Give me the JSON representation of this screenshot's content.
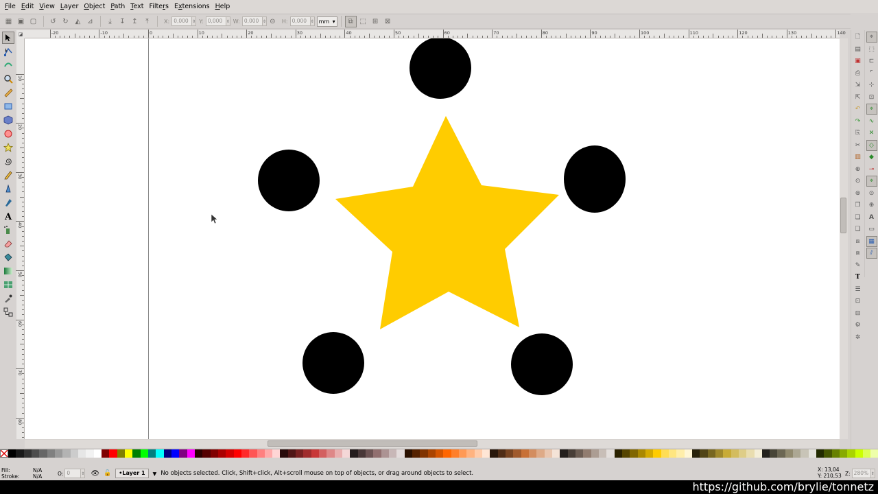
{
  "menu": [
    {
      "label": "File",
      "key": "F"
    },
    {
      "label": "Edit",
      "key": "E"
    },
    {
      "label": "View",
      "key": "V"
    },
    {
      "label": "Layer",
      "key": "L"
    },
    {
      "label": "Object",
      "key": "O"
    },
    {
      "label": "Path",
      "key": "P"
    },
    {
      "label": "Text",
      "key": "T"
    },
    {
      "label": "Filters",
      "key": "r"
    },
    {
      "label": "Extensions",
      "key": "x"
    },
    {
      "label": "Help",
      "key": "H"
    }
  ],
  "controls": {
    "x_label": "X:",
    "x_value": "0,000",
    "y_label": "Y:",
    "y_value": "0,000",
    "w_label": "W:",
    "w_value": "0,000",
    "h_label": "H:",
    "h_value": "0,000",
    "unit": "mm"
  },
  "hruler_labels": [
    "-20",
    "-10",
    "0",
    "10",
    "20",
    "30",
    "40",
    "50",
    "60",
    "70",
    "80",
    "90",
    "100",
    "110",
    "120",
    "130",
    "140"
  ],
  "vruler_labels": [
    "0",
    "10",
    "20",
    "30",
    "40",
    "50",
    "60",
    "70",
    "80",
    "90"
  ],
  "drawing": {
    "star_color": "#ffcc00",
    "circle_color": "#000000"
  },
  "palette": [
    "#000000",
    "#1a1a1a",
    "#333333",
    "#4d4d4d",
    "#666666",
    "#808080",
    "#999999",
    "#b3b3b3",
    "#cccccc",
    "#e6e6e6",
    "#f2f2f2",
    "#ffffff",
    "#800000",
    "#ff0000",
    "#808000",
    "#ffff00",
    "#008000",
    "#00ff00",
    "#008080",
    "#00ffff",
    "#000080",
    "#0000ff",
    "#800080",
    "#ff00ff",
    "#2b0000",
    "#550000",
    "#800000",
    "#aa0000",
    "#d40000",
    "#ff0000",
    "#ff2a2a",
    "#ff5555",
    "#ff8080",
    "#ffaaaa",
    "#ffd5d5",
    "#280b0b",
    "#501616",
    "#782121",
    "#a02c2c",
    "#c83737",
    "#d35f5f",
    "#de8787",
    "#e9afaf",
    "#f4d7d7",
    "#241c1c",
    "#483737",
    "#6c5353",
    "#916f6f",
    "#ac9393",
    "#c8b7b7",
    "#e3dbdb",
    "#2b1100",
    "#552200",
    "#803300",
    "#aa4400",
    "#d45500",
    "#ff6600",
    "#ff7f2a",
    "#ff9955",
    "#ffb380",
    "#ffccaa",
    "#ffe6d5",
    "#28170b",
    "#502d16",
    "#784421",
    "#a05a2c",
    "#c87137",
    "#d38d5f",
    "#deaa87",
    "#e9c6af",
    "#f4e3d7",
    "#241f1c",
    "#483e37",
    "#6c5d53",
    "#917c6f",
    "#ac9d93",
    "#c8beb7",
    "#e3dedb",
    "#2b2200",
    "#554400",
    "#806600",
    "#aa8800",
    "#d4aa00",
    "#ffcc00",
    "#ffdd55",
    "#ffe680",
    "#ffeeaa",
    "#fff6d5",
    "#28220b",
    "#504416",
    "#786721",
    "#a0892c",
    "#c8ab37",
    "#d3bc5f",
    "#decd87",
    "#e9ddaf",
    "#f4eed7",
    "#24221c",
    "#484537",
    "#6c6753",
    "#918a6f",
    "#aca793",
    "#c8c4b7",
    "#e3e2db",
    "#222b00",
    "#445500",
    "#668000",
    "#88aa00",
    "#aad400",
    "#ccff00",
    "#ddff55",
    "#eeffaa"
  ],
  "status": {
    "fill_label": "Fill:",
    "fill_value": "N/A",
    "stroke_label": "Stroke:",
    "stroke_value": "N/A",
    "opacity_label": "O:",
    "opacity_value": "0",
    "layer": "•Layer 1",
    "message": "No objects selected. Click, Shift+click, Alt+scroll mouse on top of objects, or drag around objects to select.",
    "cursor_x": "X:    13,04",
    "cursor_y": "Y:  210,53",
    "zoom_label": "Z:",
    "zoom_value": "280%"
  },
  "overlay_text": "https://github.com/brylie/tonnetz"
}
